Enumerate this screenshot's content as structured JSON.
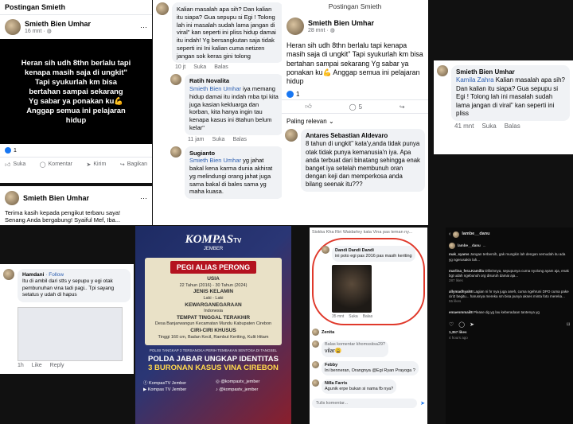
{
  "p1": {
    "header": "Postingan Smieth",
    "author": "Smieth Bien Umhar",
    "time": "16 mnt · ",
    "post_lines": [
      "Heran sih udh 8thn berlalu tapi",
      "kenapa masih saja di ungkit\"",
      "Tapi syukurlah km bisa",
      "bertahan sampai sekarang",
      "Yg sabar ya ponakan ku💪",
      "Anggap semua ini pelajaran",
      "hidup"
    ],
    "reactions": "1",
    "like": "Suka",
    "comment": "Komentar",
    "send": "Kirim",
    "share": "Bagikan"
  },
  "p2": {
    "c1_text": "Kalian masalah apa sih? Dan kalian itu siapa? Gua sepupu si Egi ! Tolong lah ini masalah sudah lama jangan di viral\" kan seperti ini pliss hidup damai itu indah! Yg bersangkutan saja tidak seperti ini Ini kalian cuma netizen jangan sok keras gini tolong",
    "c1_time": "10 jt",
    "like": "Suka",
    "reply": "Balas",
    "c2_author": "Ratih Novalita",
    "c2_mention": "Smieth Bien Umhar",
    "c2_text": " iya memang hidup damai itu indah mba tpi kita juga kasian kekluarga dan korban, kita hanya ingin tau kenapa kasus ini 8tahun belum kelar\"",
    "c2_time": "11 jam",
    "c3_author": "Sugianto",
    "c3_mention": "Smieth Bien Umhar",
    "c3_text": " yg jahat bakal kena karma dunia akhirat yg melindungi orang jahat juga sama bakal di bales sama yg maha kuasa."
  },
  "p3": {
    "header": "Postingan Smieth",
    "author": "Smieth Bien Umhar",
    "time": "28 mnt · ",
    "post_text": "Heran sih udh 8thn berlalu tapi kenapa masih saja di ungkit\" Tapi syukurlah km bisa bertahan sampai sekarang Yg sabar ya ponakan ku💪 Anggap semua ini pelajaran hidup",
    "reactions": "1",
    "comments_count": "5",
    "sort": "Paling relevan",
    "c_author": "Antares Sebastian Aldevaro",
    "c_text": "8 tahun di ungkit\" kata'y,anda tidak punya otak tidak punya kemanusia'n iya. Apa anda terbuat dari binatang sehingga enak banget iya setelah membunuh oran dengan keji dan memperkosa anda bilang seenak itu???"
  },
  "p4": {
    "author": "Smieth Bien Umhar",
    "mention": "Kamila Zahra",
    "text": " Kalian masalah apa sih? Dan kalian itu siapa? Gua sepupu si Egi ! Tolong lah ini masalah sudah lama jangan di viral\" kan seperti ini pliss",
    "time": "41 mnt",
    "like": "Suka",
    "reply": "Balas"
  },
  "p5": {
    "author": "Smieth Bien Umhar",
    "text1": "Terima kasih kepada pengikut terbaru saya!",
    "text2": "Senang Anda bergabung! Syaiful Mef, Iba..."
  },
  "p6": {
    "author": "Hamdani",
    "follow": "· Follow",
    "text": "Itu di ambil dari stts y sepupu y egi otak pembunuhan vina tadi pagi.. Tpi sayang setatus y udah di hapus",
    "time": "1h",
    "like": "Like",
    "reply": "Reply"
  },
  "p7": {
    "brand": "KOMPAS",
    "brand_tv": "TV",
    "brand_city": "JEMBER",
    "badge": "PEGI ALIAS PERONG",
    "usia_label": "USIA",
    "usia_value": "22 Tahun (2016) - 30 Tahun (2024)",
    "jk_label": "JENIS KELAMIN",
    "jk_value": "Laki - Laki",
    "kw_label": "KEWARGANEGARAAN",
    "kw_value": "Indonesia",
    "tt_label": "TEMPAT TINGGAL TERAKHIR",
    "tt_value": "Desa Banjarwangun Kecamatan Mundu Kabupaten Cirebon",
    "cc_label": "CIRI-CIRI KHUSUS",
    "cc_value": "Tinggi 160 cm, Badan Kecil, Rambut Keriting, Kulit Hitam",
    "footnote": "POLISI TANGKAP 3 TERSANGKA PERIH TEMBAKAN SENTOSA DI TANGSEL",
    "headline1": "POLDA JABAR UNGKAP IDENTITAS",
    "headline2": "3 BURONAN KASUS VINA CIREBON",
    "s1": "KompasTV Jember",
    "s2": "@kompastv_jember",
    "s3": "@kompastv_jember",
    "s4": "Kompas TV Jember"
  },
  "p8": {
    "top": "Siskka Kha  Riri Waidarley  kata Vina pas teman ny...",
    "c1_author": "Dandi Dandi Dandi",
    "c1_text": "ini poto egi pas 2016 pas masih keriting",
    "c1_time": "35 mnt",
    "like": "Suka",
    "reply": "Balas",
    "c2_author": "Zenita",
    "c3_author": "Balas komentar khomssiisa29?",
    "c3_text": "vilar😩",
    "c4_author": "Febby",
    "c4_text": "Ini benneran, Orangnya @Egi Ryan Prayoga ?",
    "c5_author": "Nilla Farris",
    "c5_text": "Agunik erpe bukan si nama fb nya?",
    "input_placeholder": "Tulis komentar..."
  },
  "p9": {
    "top_user": "lambe__danu",
    "caption_user": "lambe__danu",
    "caption": "...",
    "c1_user": "mak_syams",
    "c1_text": "Jangan terbersih, gak mungkin lah dengan semudah itu ada yg ngerusakin lah...",
    "c2_user": "marlina_fera.Kamilla",
    "c2_text": "Dilbrinnya, sepupunya cuma nyolong ayam aja, enak bgt udah ngebunuh org disuruh damai aja...",
    "c2_meta": "287 likes",
    "c3_user": "allymadhyah8",
    "c3_text": "Lagian ni hr nya juga aneh, cuma ngehruni DPO cuma pake ciri2 begitu... harusnya mereka sm bisa punya akses minta foto mereka...",
    "c3_meta": "55 likes",
    "c4_user": "emaenmmail8",
    "c4_text": "Please dg yg lau keberadaan tantenya yg",
    "likes": "1,357 likes",
    "date": "4 hours ago"
  }
}
